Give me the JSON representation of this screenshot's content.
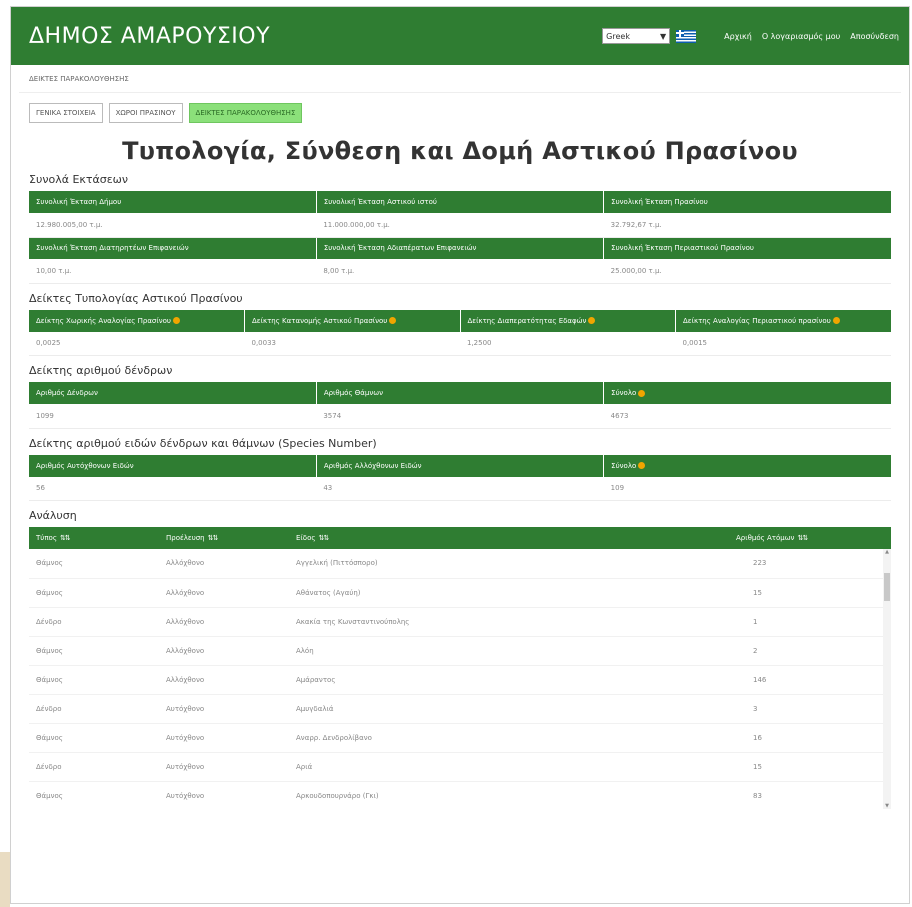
{
  "app": {
    "brand": "ΔΗΜΟΣ ΑΜΑΡΟΥΣΙΟΥ",
    "language": "Greek",
    "nav_links": [
      "Αρχική",
      "Ο λογαριασμός μου",
      "Αποσύνδεση"
    ]
  },
  "breadcrumb": "ΔΕΙΚΤΕΣ ΠΑΡΑΚΟΛΟΥΘΗΣΗΣ",
  "tabs": [
    "ΓΕΝΙΚΑ ΣΤΟΙΧΕΙΑ",
    "ΧΩΡΟΙ ΠΡΑΣΙΝΟΥ",
    "ΔΕΙΚΤΕΣ ΠΑΡΑΚΟΛΟΥΘΗΣΗΣ"
  ],
  "page_title": "Τυπολογία, Σύνθεση και Δομή Αστικού Πρασίνου",
  "sections": {
    "totals": {
      "title": "Συνολά Εκτάσεων",
      "row1_headers": [
        "Συνολική Έκταση Δήμου",
        "Συνολική Έκταση Αστικού ιστού",
        "Συνολική Έκταση Πρασίνου"
      ],
      "row1_values": [
        "12.980.005,00 τ.μ.",
        "11.000.000,00 τ.μ.",
        "32.792,67 τ.μ."
      ],
      "row2_headers": [
        "Συνολική Έκταση Διατηρητέων Επιφανειών",
        "Συνολική Έκταση Αδιαπέρατων Επιφανειών",
        "Συνολική Έκταση Περιαστικού Πρασίνου"
      ],
      "row2_values": [
        "10,00 τ.μ.",
        "8,00 τ.μ.",
        "25.000,00 τ.μ."
      ]
    },
    "typology": {
      "title": "Δείκτες Τυπολογίας Αστικού Πρασίνου",
      "headers": [
        "Δείκτης Χωρικής Αναλογίας Πρασίνου",
        "Δείκτης Κατανομής Αστικού Πρασίνου",
        "Δείκτης Διαπερατότητας Εδαφών",
        "Δείκτης Αναλογίας Περιαστικού πρασίνου"
      ],
      "values": [
        "0,0025",
        "0,0033",
        "1,2500",
        "0,0015"
      ]
    },
    "trees": {
      "title": "Δείκτης αριθμού δένδρων",
      "headers": [
        "Αριθμός Δένδρων",
        "Αριθμός Θάμνων",
        "Σύνολο"
      ],
      "values": [
        "1099",
        "3574",
        "4673"
      ]
    },
    "species": {
      "title": "Δείκτης αριθμού ειδών δένδρων και θάμνων (Species Number)",
      "headers": [
        "Αριθμός Αυτόχθονων Ειδών",
        "Αριθμός Αλλόχθονων Ειδών",
        "Σύνολο"
      ],
      "values": [
        "56",
        "43",
        "109"
      ]
    },
    "analysis": {
      "title": "Ανάλυση",
      "headers": [
        "Τύπος",
        "Προέλευση",
        "Είδος",
        "Αριθμός Ατόμων"
      ],
      "rows": [
        [
          "Θάμνος",
          "Αλλόχθονο",
          "Αγγελική (Πιττόσπορο)",
          "223"
        ],
        [
          "Θάμνος",
          "Αλλόχθονο",
          "Αθάνατος (Αγαύη)",
          "15"
        ],
        [
          "Δένδρο",
          "Αλλόχθονο",
          "Ακακία της Κωνσταντινούπολης",
          "1"
        ],
        [
          "Θάμνος",
          "Αλλόχθονο",
          "Αλόη",
          "2"
        ],
        [
          "Θάμνος",
          "Αλλόχθονο",
          "Αμάραντος",
          "146"
        ],
        [
          "Δένδρο",
          "Αυτόχθονο",
          "Αμυγδαλιά",
          "3"
        ],
        [
          "Θάμνος",
          "Αυτόχθονο",
          "Αναρρ. Δενδρολίβανο",
          "16"
        ],
        [
          "Δένδρο",
          "Αυτόχθονο",
          "Αριά",
          "15"
        ],
        [
          "Θάμνος",
          "Αυτόχθονο",
          "Αρκουδοπουρνάρο (Γκι)",
          "83"
        ]
      ]
    }
  }
}
